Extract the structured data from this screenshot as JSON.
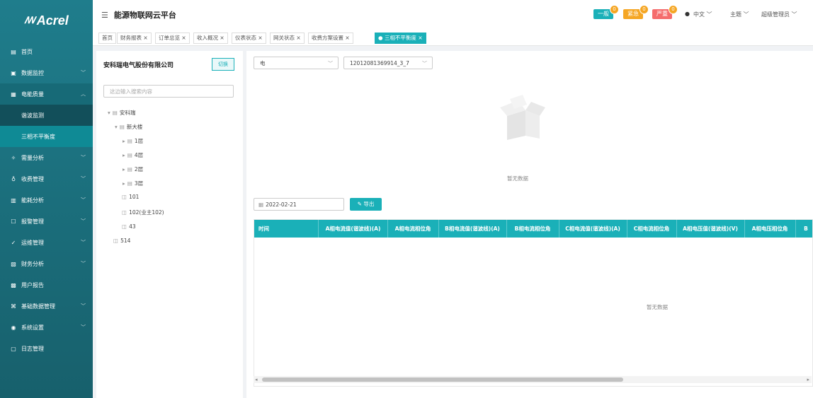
{
  "app": {
    "logo": "Acrel",
    "title": "能源物联网云平台"
  },
  "header": {
    "alerts": [
      {
        "label": "一般",
        "count": "0",
        "color": "#1ab0b8"
      },
      {
        "label": "紧急",
        "count": "0",
        "color": "#f5a623"
      },
      {
        "label": "严重",
        "count": "0",
        "color": "#f56c6c"
      }
    ],
    "language": "中文",
    "theme": "主题",
    "user": "超级管理员"
  },
  "sidebar": {
    "items": [
      {
        "label": "首页",
        "icon": "home-icon"
      },
      {
        "label": "数据监控",
        "icon": "monitor-icon"
      },
      {
        "label": "电能质量",
        "icon": "power-quality-icon"
      },
      {
        "label": "谐波监测"
      },
      {
        "label": "三相不平衡度"
      },
      {
        "label": "需量分析",
        "icon": "demand-icon"
      },
      {
        "label": "收费管理",
        "icon": "billing-icon"
      },
      {
        "label": "能耗分析",
        "icon": "chart-icon"
      },
      {
        "label": "报警管理",
        "icon": "alarm-icon"
      },
      {
        "label": "运维管理",
        "icon": "maintenance-icon"
      },
      {
        "label": "财务分析",
        "icon": "finance-icon"
      },
      {
        "label": "用户报告",
        "icon": "report-icon"
      },
      {
        "label": "基础数据管理",
        "icon": "data-icon"
      },
      {
        "label": "系统设置",
        "icon": "settings-icon"
      },
      {
        "label": "日志管理",
        "icon": "log-icon"
      }
    ]
  },
  "tabs": [
    "首页",
    "财务报表",
    "订单总览",
    "收入概况",
    "仪表状态",
    "网关状态",
    "收费方案设置",
    "三相不平衡度"
  ],
  "left": {
    "company": "安科瑞电气股份有限公司",
    "switch_label": "切换",
    "search_placeholder": "这边输入搜索内容",
    "tree": [
      "安科瑞",
      "新大楼",
      "1层",
      "4层",
      "2层",
      "3层",
      "101",
      "102(业主102)",
      "43",
      "514"
    ]
  },
  "main": {
    "energy_type": "电",
    "meter": "12012081369914_3_7",
    "no_data": "暂无数据",
    "date": "2022-02-21",
    "export_label": "导出",
    "columns": [
      "时间",
      "A相电流值(谐波线)(A)",
      "A相电流相位角",
      "B相电流值(谐波线)(A)",
      "B相电流相位角",
      "C相电流值(谐波线)(A)",
      "C相电流相位角",
      "A相电压值(谐波线)(V)",
      "A相电压相位角",
      "B"
    ],
    "table_empty": "暂无数据"
  }
}
